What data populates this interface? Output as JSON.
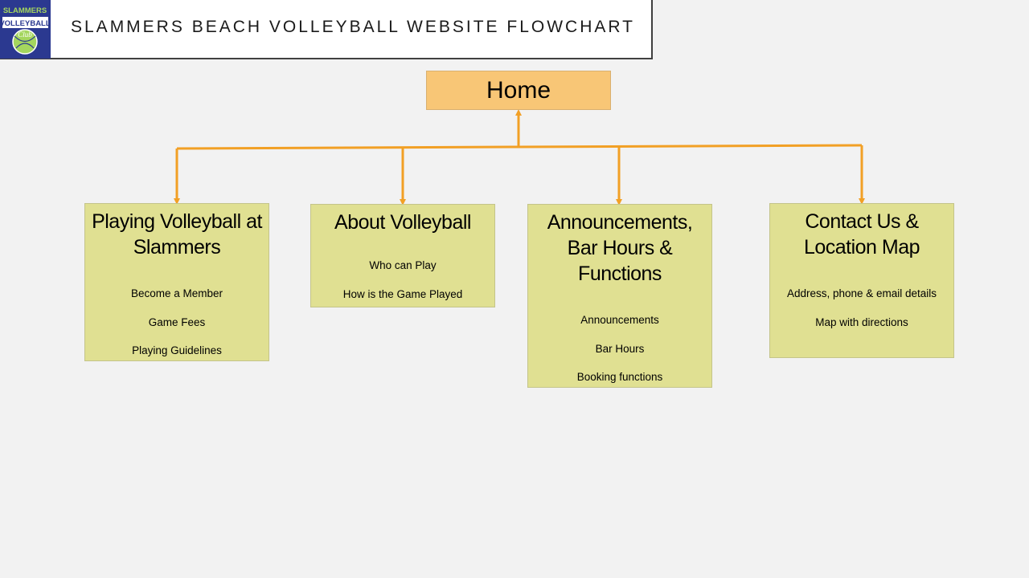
{
  "header": {
    "title": "SLAMMERS BEACH VOLLEYBALL WEBSITE FLOWCHART",
    "logo": {
      "line1": "SLAMMERS",
      "line2": "VOLLEYBALL",
      "line3": "Club",
      "bg_color": "#2b3990",
      "text_color": "#a4d65e"
    }
  },
  "root": {
    "label": "Home",
    "color": "#f8c676"
  },
  "connector_color": "#f2a025",
  "children": [
    {
      "title_lines": [
        "Playing Volleyball at",
        "Slammers"
      ],
      "items": [
        "Become a  Member",
        "Game Fees",
        "Playing Guidelines"
      ]
    },
    {
      "title_lines": [
        "About Volleyball"
      ],
      "items": [
        "Who can Play",
        "How is the Game Played"
      ]
    },
    {
      "title_lines": [
        "Announcements,",
        "Bar Hours &",
        "Functions"
      ],
      "items": [
        "Announcements",
        "Bar Hours",
        "Booking functions"
      ]
    },
    {
      "title_lines": [
        "Contact Us &",
        "Location Map"
      ],
      "items": [
        "Address, phone & email details",
        "Map with directions"
      ]
    }
  ],
  "node_color": "#e0e092"
}
